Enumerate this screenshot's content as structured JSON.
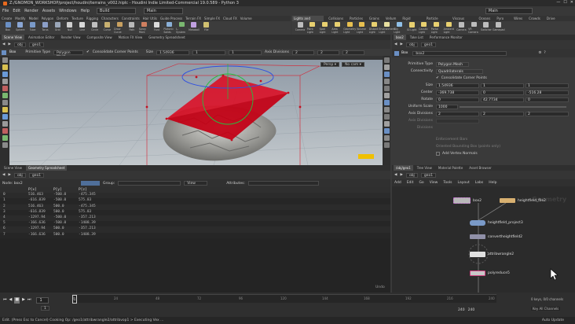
{
  "window": {
    "title": "Z:/GNOMON_WORKSHOP/project/houdini/terrains_v002.hiplc - Houdini Indie Limited-Commercial 19.0.589 - Python 3",
    "controls": [
      "—",
      "☐",
      "✕"
    ]
  },
  "menubar": {
    "items": [
      "File",
      "Edit",
      "Render",
      "Assets",
      "Windows",
      "Help"
    ],
    "desktop": "Build",
    "main": "Main",
    "right_desktop": "Main"
  },
  "shelf_left": {
    "tabs": [
      "Create",
      "Modify",
      "Model",
      "Polygon",
      "Deform",
      "Texture",
      "Rigging",
      "Characters",
      "Constraints",
      "Hair Utils",
      "Guide Process",
      "Terrain FX",
      "Simple FX",
      "Cloud FX",
      "Volume"
    ],
    "tools": [
      {
        "label": "Box",
        "color": "#6a8fc4"
      },
      {
        "label": "Sphere",
        "color": "#8aa6d4"
      },
      {
        "label": "Tube",
        "color": "#7a9ac8"
      },
      {
        "label": "Torus",
        "color": "#8c9fc8"
      },
      {
        "label": "Grid",
        "color": "#9aa6b8"
      },
      {
        "label": "Null",
        "color": "#cfcfcf"
      },
      {
        "label": "Line",
        "color": "#d8d8d8"
      },
      {
        "label": "Circle",
        "color": "#bfbfbf"
      },
      {
        "label": "Curve",
        "color": "#c8b070"
      },
      {
        "label": "Draw Curve",
        "color": "#c8a060"
      },
      {
        "label": "Path",
        "color": "#b8b8b8"
      },
      {
        "label": "Spray Paint",
        "color": "#d08060"
      },
      {
        "label": "Font",
        "color": "#dcdcdc"
      },
      {
        "label": "Platonic Solids",
        "color": "#8ab0d8"
      },
      {
        "label": "L-System",
        "color": "#7ab870"
      },
      {
        "label": "Metaball",
        "color": "#c0a0e0"
      },
      {
        "label": "File",
        "color": "#d0c070"
      }
    ]
  },
  "shelf_right": {
    "tabs": [
      "Lights and Cameras",
      "Collisions",
      "Particles",
      "Grains",
      "Vellum",
      "Rigid Bodies",
      "Particle Fluids",
      "Viscous Fluids",
      "Oceans",
      "Pyro FX",
      "Wires",
      "Crowds",
      "Drive Simulation"
    ],
    "tools": [
      {
        "label": "Camera",
        "color": "#bdbdbd"
      },
      {
        "label": "Point Light",
        "color": "#e8d070"
      },
      {
        "label": "Spot Light",
        "color": "#e8d070"
      },
      {
        "label": "Area Light",
        "color": "#e8d070"
      },
      {
        "label": "Geometry Light",
        "color": "#e8c050"
      },
      {
        "label": "Volume Light",
        "color": "#e8c050"
      },
      {
        "label": "Distant Light",
        "color": "#e8d070"
      },
      {
        "label": "Environment Light",
        "color": "#e8e0a0"
      },
      {
        "label": "Sky Light",
        "color": "#90c0e8"
      },
      {
        "label": "GI Light",
        "color": "#e8d070"
      },
      {
        "label": "Caustic Light",
        "color": "#e8d070"
      },
      {
        "label": "Portal Light",
        "color": "#e8d070"
      },
      {
        "label": "Ambient Light",
        "color": "#e8d070"
      },
      {
        "label": "Camera",
        "color": "#bdbdbd"
      },
      {
        "label": "VR Camera",
        "color": "#bdbdbd"
      },
      {
        "label": "Switcher",
        "color": "#bdbdbd"
      },
      {
        "label": "Gamepad",
        "color": "#bdbdbd"
      }
    ]
  },
  "viewer": {
    "tabs": [
      "Scene View",
      "Animation Editor",
      "Render View",
      "Composite View",
      "Motion FX View",
      "Geometry Spreadsheet"
    ],
    "path": [
      "obj",
      "geo1"
    ],
    "op_bar": {
      "node": "Box",
      "primitive_type_label": "Primitive Type",
      "primitive_type": "Polygon Mesh",
      "consolidate": "Consolidate Corner Points",
      "size_label": "Size",
      "size": "1.54936",
      "size2": "1",
      "size3": "1",
      "axis_div_label": "Axis Divisions",
      "div1": "2",
      "div2": "2",
      "div3": "2"
    },
    "view_buttons": {
      "persp": "Persp ▾",
      "cam": "No cam ▾"
    }
  },
  "spreadsheet": {
    "tabs": [
      "Scene View",
      "Geometry Spreadsheet"
    ],
    "path": [
      "obj",
      "geo1"
    ],
    "node": "Node: box2",
    "group": "Group:",
    "view": "View",
    "attributes": "Attributes:",
    "columns": [
      "",
      "P[x]",
      "P[y]",
      "P[z]"
    ],
    "rows": [
      [
        "0",
        "516.463",
        "-500.0",
        "-475.345"
      ],
      [
        "1",
        "-616.839",
        "-500.0",
        "575.83"
      ],
      [
        "2",
        "516.463",
        "500.0",
        "-475.345"
      ],
      [
        "3",
        "-616.839",
        "500.0",
        "575.83"
      ],
      [
        "4",
        "-1297.94",
        "-500.0",
        "-357.213"
      ],
      [
        "5",
        "-166.636",
        "-500.0",
        "-1408.39"
      ],
      [
        "6",
        "-1297.94",
        "500.0",
        "-357.213"
      ],
      [
        "7",
        "-166.636",
        "500.0",
        "-1408.39"
      ]
    ],
    "footer": "Undo"
  },
  "params": {
    "tabs": [
      "box2",
      "Take List",
      "Performance Monitor"
    ],
    "path": [
      "obj",
      "geo1"
    ],
    "node_type": "Box",
    "node_name": "box2",
    "primitive_type": "Polygon Mesh",
    "connectivity": "Quadrilaterals",
    "consolidate": "Consolidate Corner Points",
    "size": [
      "1.54936",
      "1",
      "1"
    ],
    "center": [
      "-369.738",
      "0",
      "-516.28"
    ],
    "rotate": [
      "0",
      "42.7734",
      "0"
    ],
    "uniform_scale": "1000",
    "axis_divisions": [
      "2",
      "2",
      "2"
    ],
    "labels": {
      "primitive_type": "Primitive Type",
      "connectivity": "Connectivity",
      "size": "Size",
      "center": "Center",
      "rotate": "Rotate",
      "uniform_scale": "Uniform Scale",
      "axis_divisions": "Axis Divisions",
      "axis_divisions2": "Axis Divisions",
      "divisions": "Divisions"
    },
    "dim1": "Enforcement Bars",
    "dim2": "Oriented Bounding Box (points only)",
    "add_normals": "Add Vertex Normals"
  },
  "network": {
    "tabs": [
      "/obj/geo1",
      "Tree View",
      "Material Palette",
      "Asset Browser"
    ],
    "path": [
      "obj",
      "geo1"
    ],
    "menu": [
      "Add",
      "Edit",
      "Go",
      "View",
      "Tools",
      "Layout",
      "Labs",
      "Help"
    ],
    "watermark": "Geometry",
    "nodes": [
      "box2",
      "heightfield_file2",
      "heightfield_project3",
      "convertheightfield2",
      "attribwrangle2",
      "polyreduce5"
    ]
  },
  "timeline": {
    "frame": "1",
    "start": "1",
    "end": "240",
    "end2": "240",
    "ticks": [
      "1",
      "24",
      "48",
      "72",
      "96",
      "120",
      "144",
      "168",
      "192",
      "216",
      "240"
    ],
    "keys_label": "0 keys, 0/0 channels",
    "key_all": "Key All Channels",
    "auto_update": "Auto Update"
  },
  "status": {
    "text": "Edit. (Press Esc to Cancel) Cooking Op: /geo1/attribwrangle2/attribvop1 > Executing Vex ..."
  }
}
